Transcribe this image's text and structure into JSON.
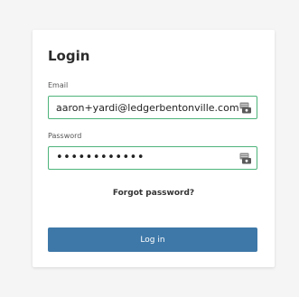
{
  "login": {
    "title": "Login",
    "email_label": "Email",
    "email_value": "aaron+yardi@ledgerbentonville.com",
    "password_label": "Password",
    "password_masked": "••••••••••••",
    "forgot_link": "Forgot password?",
    "submit_label": "Log in"
  },
  "icons": {
    "email_field_icon": "password-manager-icon",
    "password_field_icon": "password-manager-icon"
  },
  "colors": {
    "page_background": "#f5f5f5",
    "card_background": "#ffffff",
    "field_border_focus": "#4db37a",
    "button_background": "#3e78a8",
    "button_text": "#ffffff"
  }
}
